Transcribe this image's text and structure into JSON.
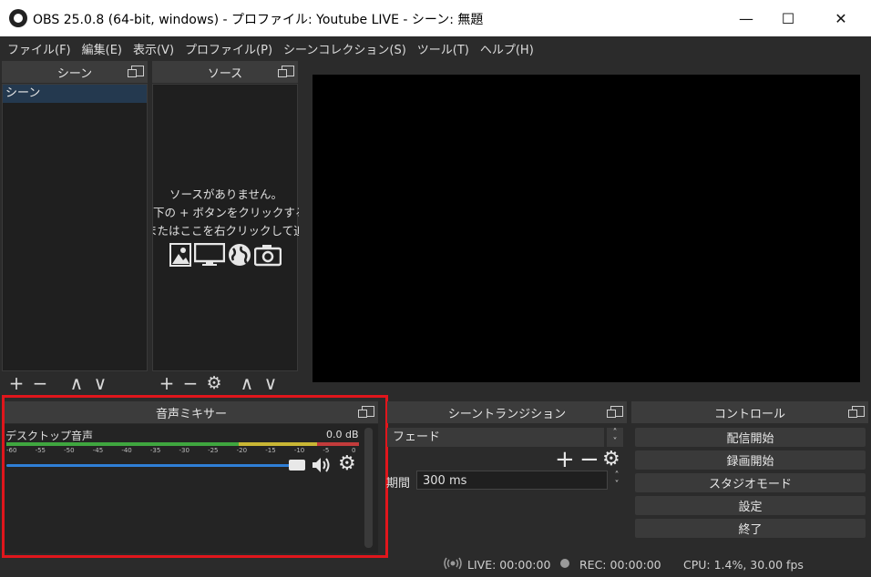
{
  "window": {
    "title": "OBS 25.0.8 (64-bit, windows) - プロファイル: Youtube LIVE - シーン: 無題",
    "minimize": "—",
    "maximize": "☐",
    "close": "✕"
  },
  "menubar": [
    "ファイル(F)",
    "編集(E)",
    "表示(V)",
    "プロファイル(P)",
    "シーンコレクション(S)",
    "ツール(T)",
    "ヘルプ(H)"
  ],
  "scenes": {
    "title": "シーン",
    "items": [
      "シーン"
    ],
    "toolbar": {
      "add": "+",
      "remove": "−",
      "up": "∧",
      "down": "∨"
    }
  },
  "sources": {
    "title": "ソース",
    "empty_line1": "ソースがありません。",
    "empty_line2": "下の + ボタンをクリックするか、",
    "empty_line3": "またはここを右クリックして追加してください",
    "icons": [
      "image-icon",
      "monitor-icon",
      "globe-icon",
      "camera-icon"
    ],
    "toolbar": {
      "add": "+",
      "remove": "−",
      "up": "∧",
      "down": "∨"
    }
  },
  "mixer": {
    "title": "音声ミキサー",
    "track_name": "デスクトップ音声",
    "level": "0.0 dB",
    "volume": 1.0,
    "scale": [
      "-60",
      "-55",
      "-50",
      "-45",
      "-40",
      "-35",
      "-30",
      "-25",
      "-20",
      "-15",
      "-10",
      "-5",
      "0"
    ]
  },
  "transitions": {
    "title": "シーントランジション",
    "selected": "フェード",
    "duration_label": "期間",
    "duration_value": "300 ms"
  },
  "controls": {
    "title": "コントロール",
    "buttons": [
      "配信開始",
      "録画開始",
      "スタジオモード",
      "設定",
      "終了"
    ]
  },
  "status": {
    "live": "LIVE: 00:00:00",
    "rec": "REC: 00:00:00",
    "cpu": "CPU: 1.4%, 30.00 fps"
  },
  "colors": {
    "highlight": "#e0161c",
    "selected_scene": "#24394f",
    "meter_green": "#3fa63f",
    "meter_yellow": "#c9b634",
    "meter_red": "#c23b3b",
    "volume_slider": "#2f7fd6"
  }
}
